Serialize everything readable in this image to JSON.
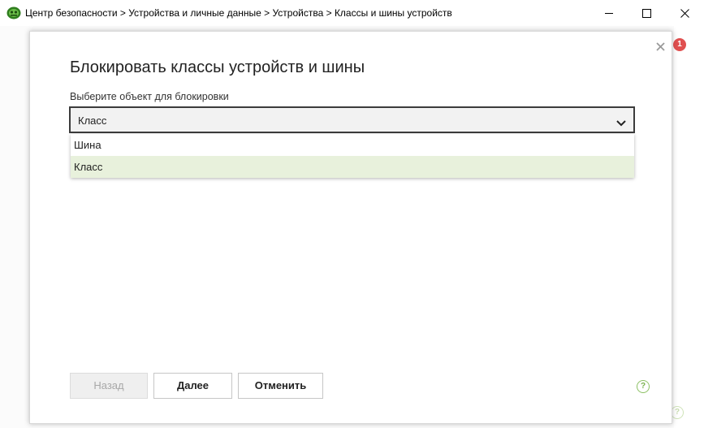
{
  "window": {
    "title": "Центр безопасности > Устройства и личные данные > Устройства > Классы и шины устройств",
    "minimize_icon": "minimize-icon",
    "maximize_icon": "maximize-icon",
    "close_icon": "close-icon"
  },
  "background": {
    "notification_count": "1",
    "help_glyph": "?"
  },
  "dialog": {
    "title": "Блокировать классы устройств и шины",
    "field_label": "Выберите объект для блокировки",
    "select": {
      "selected_value": "Класс",
      "options": [
        "Шина",
        "Класс"
      ]
    },
    "buttons": {
      "back": "Назад",
      "next": "Далее",
      "cancel": "Отменить"
    },
    "help_glyph": "?"
  },
  "colors": {
    "accent_green": "#7ab24e",
    "highlight_option": "#e8f1dc",
    "badge_red": "#e05050"
  }
}
